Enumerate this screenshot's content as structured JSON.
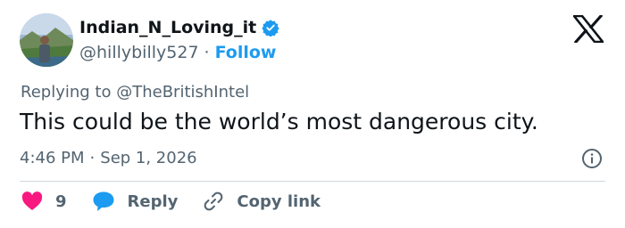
{
  "user": {
    "display_name": "Indian_N_Loving_it",
    "handle": "@hillybilly527",
    "separator": "·",
    "follow_label": "Follow"
  },
  "tweet": {
    "replying_prefix": "Replying to",
    "replying_to": "@TheBritishIntel",
    "text": "This could be the world’s most dangerous city.",
    "time": "4:46 PM",
    "date_separator": "·",
    "date": "Sep 1, 2026"
  },
  "actions": {
    "like_count": "9",
    "reply_label": "Reply",
    "copy_link_label": "Copy link"
  },
  "colors": {
    "accent": "#1d9bf0",
    "like": "#f91880",
    "muted": "#536471",
    "text": "#0f1419"
  },
  "icons": [
    "x-logo-icon",
    "verified-badge-icon",
    "info-icon",
    "heart-icon",
    "reply-bubble-icon",
    "link-icon"
  ]
}
